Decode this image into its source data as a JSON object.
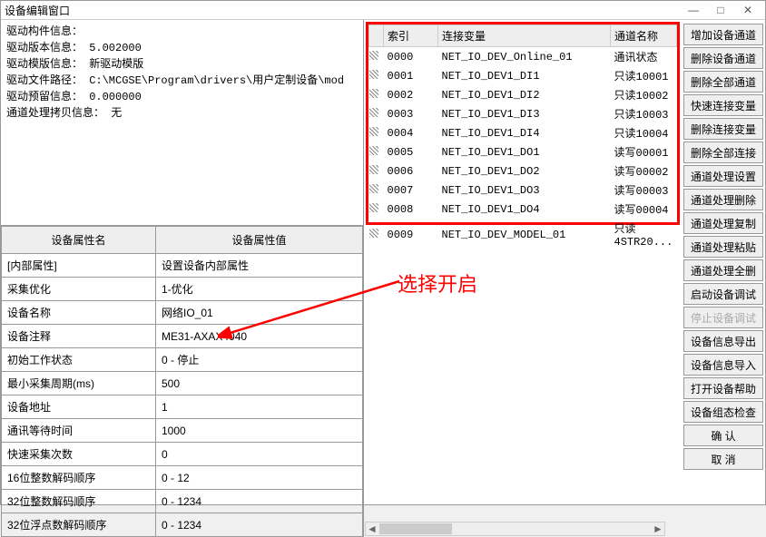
{
  "window": {
    "title": "设备编辑窗口"
  },
  "info": {
    "line1": "驱动构件信息：",
    "line2": "驱动版本信息： 5.002000",
    "line3": "驱动模版信息： 新驱动模版",
    "line4": "驱动文件路径： C:\\MCGSE\\Program\\drivers\\用户定制设备\\mod",
    "line5": "驱动预留信息： 0.000000",
    "line6": "通道处理拷贝信息： 无"
  },
  "propgrid": {
    "col_name": "设备属性名",
    "col_val": "设备属性值",
    "rows": [
      {
        "n": "[内部属性]",
        "v": "设置设备内部属性"
      },
      {
        "n": "采集优化",
        "v": "1-优化"
      },
      {
        "n": "设备名称",
        "v": "网络IO_01"
      },
      {
        "n": "设备注释",
        "v": "ME31-AXAX4040"
      },
      {
        "n": "初始工作状态",
        "v": "0 - 停止"
      },
      {
        "n": "最小采集周期(ms)",
        "v": "500"
      },
      {
        "n": "设备地址",
        "v": "1"
      },
      {
        "n": "通讯等待时间",
        "v": "1000"
      },
      {
        "n": "快速采集次数",
        "v": "0"
      },
      {
        "n": "16位整数解码顺序",
        "v": "0 - 12"
      },
      {
        "n": "32位整数解码顺序",
        "v": "0 - 1234"
      },
      {
        "n": "32位浮点数解码顺序",
        "v": "0 - 1234"
      }
    ]
  },
  "channels": {
    "cols": {
      "idx": "索引",
      "var": "连接变量",
      "name": "通道名称"
    },
    "rows": [
      {
        "idx": "0000",
        "var": "NET_IO_DEV_Online_01",
        "name": "通讯状态"
      },
      {
        "idx": "0001",
        "var": "NET_IO_DEV1_DI1",
        "name": "只读10001"
      },
      {
        "idx": "0002",
        "var": "NET_IO_DEV1_DI2",
        "name": "只读10002"
      },
      {
        "idx": "0003",
        "var": "NET_IO_DEV1_DI3",
        "name": "只读10003"
      },
      {
        "idx": "0004",
        "var": "NET_IO_DEV1_DI4",
        "name": "只读10004"
      },
      {
        "idx": "0005",
        "var": "NET_IO_DEV1_DO1",
        "name": "读写00001"
      },
      {
        "idx": "0006",
        "var": "NET_IO_DEV1_DO2",
        "name": "读写00002"
      },
      {
        "idx": "0007",
        "var": "NET_IO_DEV1_DO3",
        "name": "读写00003"
      },
      {
        "idx": "0008",
        "var": "NET_IO_DEV1_DO4",
        "name": "读写00004"
      },
      {
        "idx": "0009",
        "var": "NET_IO_DEV_MODEL_01",
        "name": "只读4STR20..."
      }
    ]
  },
  "buttons": {
    "add_channel": "增加设备通道",
    "del_channel": "删除设备通道",
    "del_all_channel": "删除全部通道",
    "fast_link_var": "快速连接变量",
    "del_link_var": "删除连接变量",
    "del_all_link": "删除全部连接",
    "proc_set": "通道处理设置",
    "proc_del": "通道处理删除",
    "proc_copy": "通道处理复制",
    "proc_paste": "通道处理粘贴",
    "proc_clear": "通道处理全删",
    "start_debug": "启动设备调试",
    "stop_debug": "停止设备调试",
    "info_export": "设备信息导出",
    "info_import": "设备信息导入",
    "open_help": "打开设备帮助",
    "config_check": "设备组态检查",
    "confirm": "确   认",
    "cancel": "取   消"
  },
  "annotation": {
    "text": "选择开启"
  }
}
